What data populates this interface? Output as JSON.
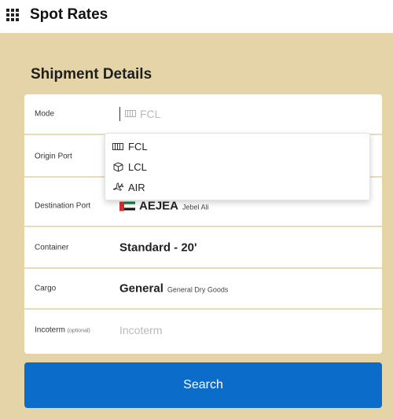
{
  "header": {
    "title": "Spot Rates",
    "menu_icon": "grid-icon"
  },
  "section": {
    "title": "Shipment Details"
  },
  "form": {
    "mode": {
      "label": "Mode",
      "placeholder": "FCL"
    },
    "origin_port": {
      "label": "Origin Port"
    },
    "destination_port": {
      "label": "Destination Port",
      "code": "AEJEA",
      "name": "Jebel Ali",
      "flag": "uae-flag-icon"
    },
    "container": {
      "label": "Container",
      "value": "Standard - 20'"
    },
    "cargo": {
      "label": "Cargo",
      "value": "General",
      "detail": "General Dry Goods"
    },
    "incoterm": {
      "label": "Incoterm",
      "optional": "(optional)",
      "placeholder": "Incoterm"
    }
  },
  "mode_dropdown": {
    "options": [
      {
        "label": "FCL",
        "icon": "container-icon"
      },
      {
        "label": "LCL",
        "icon": "box-icon"
      },
      {
        "label": "AIR",
        "icon": "airplane-icon"
      }
    ]
  },
  "actions": {
    "search_label": "Search"
  },
  "colors": {
    "page_bg": "#e5d4a8",
    "primary": "#0b6cc9",
    "divider": "#e9dcb8"
  }
}
